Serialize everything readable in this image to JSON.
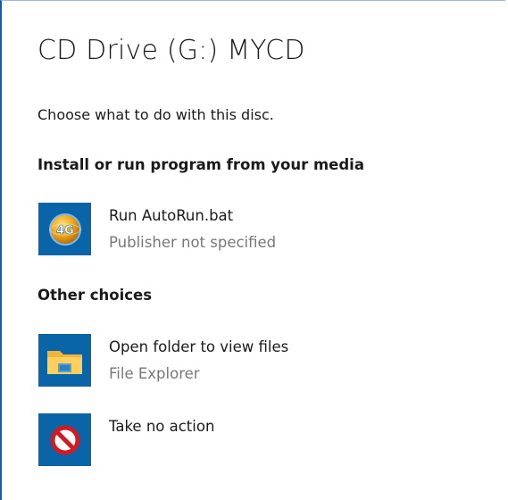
{
  "dialog": {
    "title": "CD Drive (G:) MYCD",
    "subtitle": "Choose what to do with this disc."
  },
  "sections": [
    {
      "heading": "Install or run program from your media",
      "options": [
        {
          "label": "Run AutoRun.bat",
          "sublabel": "Publisher not specified",
          "icon": "autorun-4g-icon"
        }
      ]
    },
    {
      "heading": "Other choices",
      "options": [
        {
          "label": "Open folder to view files",
          "sublabel": "File Explorer",
          "icon": "folder-icon"
        },
        {
          "label": "Take no action",
          "icon": "no-action-icon"
        }
      ]
    }
  ],
  "icon_text": {
    "autorun": "4G"
  },
  "colors": {
    "accent": "#0a5fb8",
    "icon_tile": "#0a64a8",
    "secondary_text": "#777777",
    "no_action_red": "#d11b24"
  }
}
